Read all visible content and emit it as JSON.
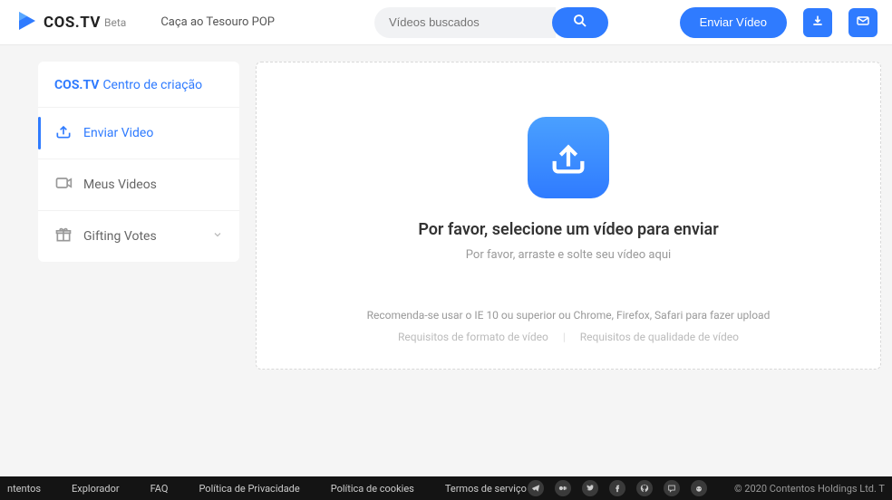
{
  "header": {
    "logo": "COS.TV",
    "beta": "Beta",
    "promo": "Caça ao Tesouro POP",
    "search_placeholder": "Vídeos buscados",
    "send_video": "Enviar Vídeo"
  },
  "sidebar": {
    "brand": "COS.TV",
    "title": "Centro de criação",
    "items": [
      {
        "label": "Enviar Video"
      },
      {
        "label": "Meus Videos"
      },
      {
        "label": "Gifting Votes"
      }
    ]
  },
  "upload": {
    "title": "Por favor, selecione um vídeo para enviar",
    "subtitle": "Por favor, arraste e solte seu vídeo aqui",
    "hint": "Recomenda-se usar o IE 10 ou superior ou Chrome, Firefox, Safari para fazer upload",
    "link_format": "Requisitos de formato de vídeo",
    "link_quality": "Requisitos de qualidade de vídeo"
  },
  "footer": {
    "links": [
      "ntentos",
      "Explorador",
      "FAQ",
      "Política de Privacidade",
      "Política de cookies",
      "Termos de serviço"
    ],
    "copyright": "© 2020 Contentos Holdings Ltd. T"
  }
}
